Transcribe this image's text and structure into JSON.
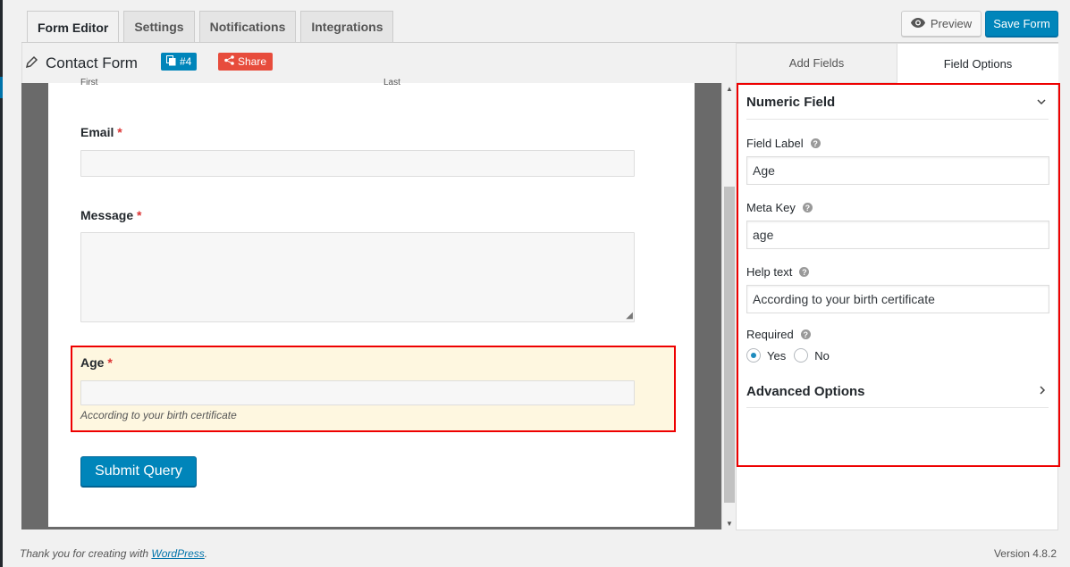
{
  "tabs": [
    {
      "label": "Form Editor"
    },
    {
      "label": "Settings"
    },
    {
      "label": "Notifications"
    },
    {
      "label": "Integrations"
    }
  ],
  "toolbar": {
    "preview_label": "Preview",
    "save_label": "Save Form"
  },
  "form": {
    "title": "Contact Form",
    "id_badge": "#4",
    "share_label": "Share"
  },
  "preview": {
    "name_sublabels": {
      "first": "First",
      "last": "Last"
    },
    "fields": {
      "email": {
        "label": "Email",
        "required": "*"
      },
      "message": {
        "label": "Message",
        "required": "*"
      },
      "age": {
        "label": "Age",
        "required": "*",
        "help": "According to your birth certificate"
      }
    },
    "submit_label": "Submit Query"
  },
  "panel": {
    "tabs": {
      "add": "Add Fields",
      "options": "Field Options"
    },
    "section_title": "Numeric Field",
    "field_label": {
      "label": "Field Label",
      "value": "Age"
    },
    "meta_key": {
      "label": "Meta Key",
      "value": "age"
    },
    "help_text": {
      "label": "Help text",
      "value": "According to your birth certificate"
    },
    "required": {
      "label": "Required",
      "yes": "Yes",
      "no": "No",
      "selected": "Yes"
    },
    "advanced": "Advanced Options"
  },
  "footer": {
    "prefix": "Thank you for creating with ",
    "link": "WordPress",
    "suffix": ".",
    "version": "Version 4.8.2"
  }
}
